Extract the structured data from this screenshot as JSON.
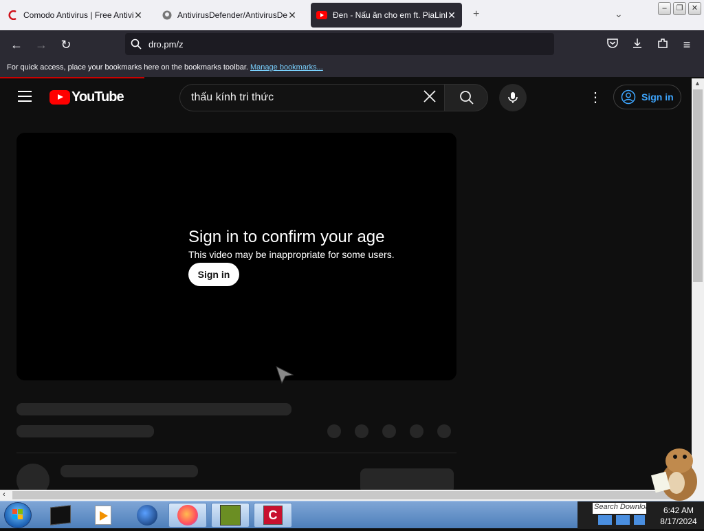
{
  "tabs": [
    {
      "title": "Comodo Antivirus | Free Antivirus",
      "close": "✕",
      "icon": "comodo-icon"
    },
    {
      "title": "AntivirusDefender/AntivirusDefender",
      "close": "✕",
      "icon": "github-icon"
    },
    {
      "title": "Đen - Nấu ăn cho em ft. PiaLinh",
      "close": "✕",
      "icon": "youtube-icon",
      "active": true
    }
  ],
  "window_controls": {
    "minimize": "–",
    "maximize": "❐",
    "close": "✕"
  },
  "url": "dro.pm/z",
  "bookmarks_bar": {
    "text": "For quick access, place your bookmarks here on the bookmarks toolbar.",
    "link": "Manage bookmarks..."
  },
  "youtube": {
    "logo_text": "YouTube",
    "search_value": "thấu kính tri thức",
    "signin_label": "Sign in"
  },
  "age_gate": {
    "title": "Sign in to confirm your age",
    "subtitle": "This video may be inappropriate for some users.",
    "button": "Sign in"
  },
  "tray": {
    "search_text": "Search Downloads",
    "time": "6:42 AM",
    "date": "8/17/2024"
  },
  "colors": {
    "youtube_red": "#ff0000",
    "link_blue": "#3ea6ff",
    "firefox_dark": "#2b2a33"
  }
}
